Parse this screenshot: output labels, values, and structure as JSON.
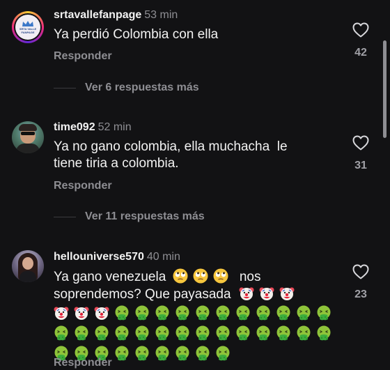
{
  "comments": [
    {
      "username": "srtavallefanpage",
      "time": "53 min",
      "text": "Ya perdió Colombia con ella",
      "likes": "42",
      "reply_label": "Responder",
      "view_replies": "Ver 6 respuestas más",
      "avatar_text": "SRTA VALLE FANPAGE"
    },
    {
      "username": "time092",
      "time": "52 min",
      "text_line1": "Ya no gano colombia, ella muchacha  le",
      "text_line2": "tiene tiria a colombia.",
      "likes": "31",
      "reply_label": "Responder",
      "view_replies": "Ver 11 respuestas más"
    },
    {
      "username": "hellouniverse570",
      "time": "40 min",
      "text_part1": "Ya gano venezuela",
      "text_part2": "nos",
      "text_line2": "soprendemos? Que payasada",
      "likes": "23",
      "reply_label": "Responder"
    }
  ],
  "icons": {
    "like": "heart-outline-icon",
    "rolling_eyes": "rolling-eyes-emoji",
    "clown": "clown-face-emoji",
    "vomit": "vomiting-face-emoji"
  },
  "colors": {
    "background": "#121214",
    "text_primary": "#f2f2f2",
    "text_secondary": "#8e8e93"
  }
}
